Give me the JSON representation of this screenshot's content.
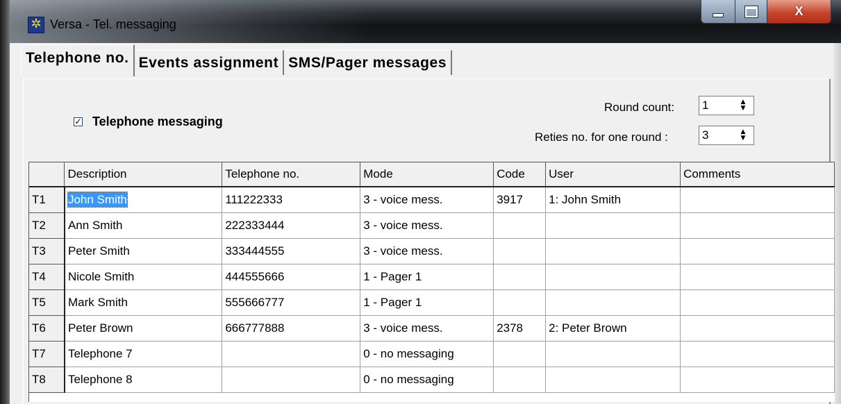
{
  "window": {
    "title": "Versa - Tel. messaging",
    "app_icon": "star-emblem-icon",
    "controls": {
      "minimize": "minimize-icon",
      "maximize": "maximize-icon",
      "close": "X"
    }
  },
  "tabs": [
    {
      "label": "Telephone no.",
      "active": true
    },
    {
      "label": "Events assignment",
      "active": false
    },
    {
      "label": "SMS/Pager messages",
      "active": false
    }
  ],
  "telephone_messaging": {
    "label": "Telephone messaging",
    "checked": true
  },
  "round_count": {
    "label": "Round count:",
    "value": "1"
  },
  "retries": {
    "label": "Reties no. for one round :",
    "value": "3"
  },
  "table": {
    "columns": [
      "Description",
      "Telephone no.",
      "Mode",
      "Code",
      "User",
      "Comments"
    ],
    "rows": [
      {
        "id": "T1",
        "description": "John Smith",
        "telephone": "111222333",
        "mode": "3 - voice mess.",
        "code": "3917",
        "user": "1: John Smith",
        "comments": ""
      },
      {
        "id": "T2",
        "description": "Ann Smith",
        "telephone": "222333444",
        "mode": "3 - voice mess.",
        "code": "",
        "user": "",
        "comments": ""
      },
      {
        "id": "T3",
        "description": "Peter Smith",
        "telephone": "333444555",
        "mode": "3 - voice mess.",
        "code": "",
        "user": "",
        "comments": ""
      },
      {
        "id": "T4",
        "description": "Nicole Smith",
        "telephone": "444555666",
        "mode": "1 - Pager 1",
        "code": "",
        "user": "",
        "comments": ""
      },
      {
        "id": "T5",
        "description": "Mark Smith",
        "telephone": "555666777",
        "mode": "1 - Pager 1",
        "code": "",
        "user": "",
        "comments": ""
      },
      {
        "id": "T6",
        "description": "Peter Brown",
        "telephone": "666777888",
        "mode": "3 - voice mess.",
        "code": "2378",
        "user": "2: Peter Brown",
        "comments": ""
      },
      {
        "id": "T7",
        "description": "Telephone 7",
        "telephone": "",
        "mode": "0 - no messaging",
        "code": "",
        "user": "",
        "comments": ""
      },
      {
        "id": "T8",
        "description": "Telephone 8",
        "telephone": "",
        "mode": "0 - no messaging",
        "code": "",
        "user": "",
        "comments": ""
      }
    ],
    "selected_cell": "John Smith"
  },
  "colors": {
    "selection": "#3399ff",
    "close_button": "#c8452c",
    "window_frame": "#1d2024"
  }
}
